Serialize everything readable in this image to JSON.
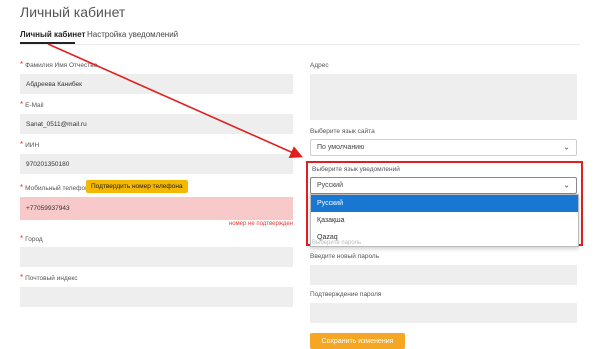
{
  "header": {
    "title": "Личный кабинет"
  },
  "tabs": [
    {
      "label": "Личный кабинет"
    },
    {
      "label": "Настройка уведомлений"
    }
  ],
  "left": {
    "fio_label": "Фамилия Имя Отчество",
    "fio_value": "Абдреева Канибек",
    "email_label": "E-Mail",
    "email_value": "Sanat_0511@mail.ru",
    "iin_label": "ИИН",
    "iin_value": "970201350180",
    "phone_label": "Мобильный телефон",
    "phone_confirm_btn": "Подтвердить номер телефона",
    "phone_value": "+77059937943",
    "phone_error": "номер не подтвержден",
    "city_label": "Город",
    "city_value": "",
    "postal_label": "Почтовый индекс",
    "postal_value": "",
    "required_mark": "*"
  },
  "right": {
    "address_label": "Адрес",
    "site_lang_label": "Выберите язык сайта",
    "site_lang_value": "По умолчанию",
    "notif_lang_label": "Выберите язык уведомлений",
    "notif_lang_value": "Русский",
    "notif_lang_options": [
      "Русский",
      "Қазақша",
      "Qazaq"
    ],
    "notif_lang_selected_index": 0,
    "hidden_hint": "Выберите пароль",
    "new_password_label": "Введите новый пароль",
    "confirm_password_label": "Подтверждение пароля",
    "save_button": "Сохранить изменения"
  },
  "icons": {
    "chevron": "chevron-down-icon"
  },
  "colors": {
    "accent_yellow": "#f5b800",
    "highlight_red": "#e02020",
    "selected_blue": "#1877d2",
    "error_bg": "#f8c9c9",
    "save_orange": "#f5a623"
  }
}
